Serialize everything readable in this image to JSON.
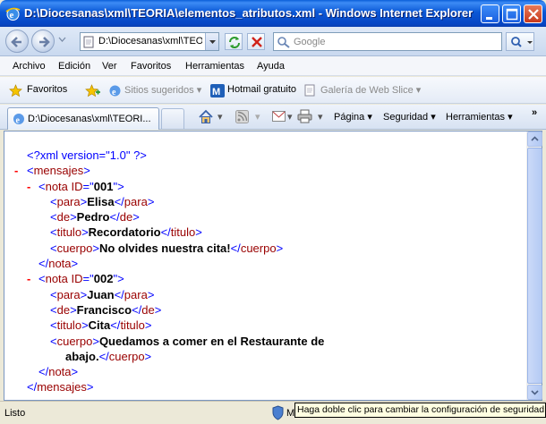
{
  "window": {
    "title": "D:\\Diocesanas\\xml\\TEORIA\\elementos_atributos.xml - Windows Internet Explorer"
  },
  "address_bar": {
    "value": "D:\\Diocesanas\\xml\\TEORIA\\elementos_atributos.xml"
  },
  "search": {
    "placeholder": "Google"
  },
  "menu": {
    "items": [
      "Archivo",
      "Edición",
      "Ver",
      "Favoritos",
      "Herramientas",
      "Ayuda"
    ]
  },
  "favorites_bar": {
    "favorites_label": "Favoritos",
    "suggested_sites": "Sitios sugeridos",
    "hotmail": "Hotmail gratuito",
    "web_slice": "Galería de Web Slice"
  },
  "tab": {
    "label": "D:\\Diocesanas\\xml\\TEORI..."
  },
  "command_bar": {
    "page": "Página",
    "security": "Seguridad",
    "tools": "Herramientas"
  },
  "xml": {
    "declaration": "<?xml version=\"1.0\" ?>",
    "root": "mensajes",
    "notes": [
      {
        "id": "001",
        "para": "Elisa",
        "de": "Pedro",
        "titulo": "Recordatorio",
        "cuerpo": "No olvides nuestra cita!"
      },
      {
        "id": "002",
        "para": "Juan",
        "de": "Francisco",
        "titulo": "Cita",
        "cuerpo_line1": "Quedamos a comer en el Restaurante de",
        "cuerpo_line2": "abajo."
      }
    ]
  },
  "status": {
    "text": "Listo",
    "tooltip": "Haga doble clic para cambiar la configuración de seguridad"
  },
  "colors": {
    "tag": "#990000",
    "markup": "#0000ff",
    "collapse": "#ff0000",
    "titlebar": "#0b58d6"
  }
}
